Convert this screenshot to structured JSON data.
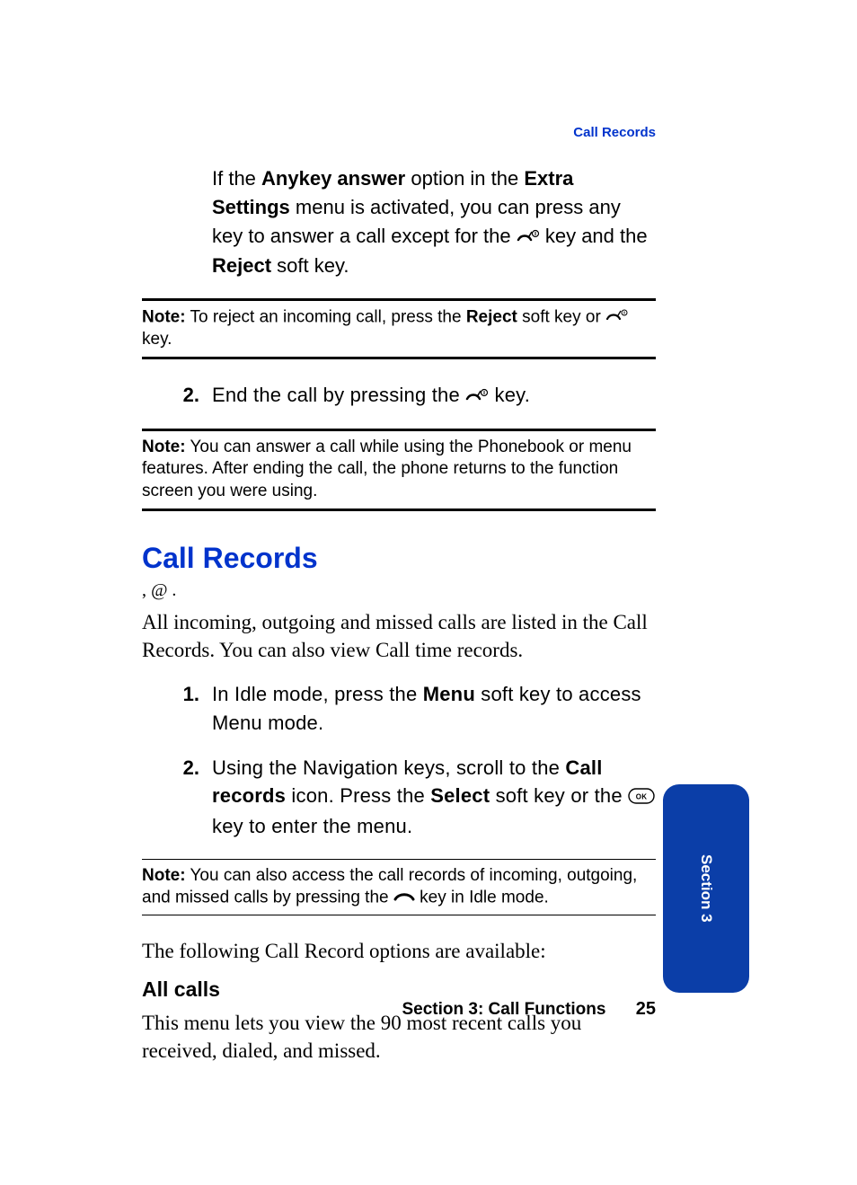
{
  "running_head": "Call Records",
  "intro": {
    "pre": "If the ",
    "b1": "Anykey answer",
    "mid1": " option in the ",
    "b2": "Extra Settings",
    "mid2": " menu is activated, you can press any key to answer a call except for the ",
    "mid3": " key and the ",
    "b3": "Reject",
    "post": " soft key."
  },
  "note1": {
    "label": "Note:",
    "pre": " To reject an incoming call, press the ",
    "b1": "Reject",
    "mid": " soft key or ",
    "post": " key."
  },
  "step_end": {
    "num": "2.",
    "pre": "End the call by pressing the ",
    "post": " key."
  },
  "note2": {
    "label": "Note:",
    "text": " You can answer a call while using the Phonebook or menu features. After ending the call, the phone returns to the function screen you were using."
  },
  "h1": "Call Records",
  "aux": ", @ .",
  "desc": "All incoming, outgoing and missed calls are listed in the Call Records. You can also view Call time records.",
  "step1": {
    "num": "1.",
    "pre": "In Idle mode, press the ",
    "b1": "Menu",
    "post": " soft key to access Menu mode."
  },
  "step2": {
    "num": "2.",
    "pre": "Using the Navigation keys, scroll to the ",
    "b1": "Call records",
    "mid": " icon. Press the ",
    "b2": "Select",
    "mid2": " soft key or the ",
    "post": " key to enter the menu."
  },
  "note3": {
    "label": "Note:",
    "pre": " You can also access the call records of incoming, outgoing, and missed calls by pressing the ",
    "post": " key in Idle mode."
  },
  "options_intro": "The following Call Record options are available:",
  "h2": "All calls",
  "allcalls_body": "This menu lets you view the 90 most recent calls you received, dialed, and missed.",
  "footer_section": "Section 3: Call Functions",
  "footer_page": "25",
  "side_tab": "Section 3"
}
